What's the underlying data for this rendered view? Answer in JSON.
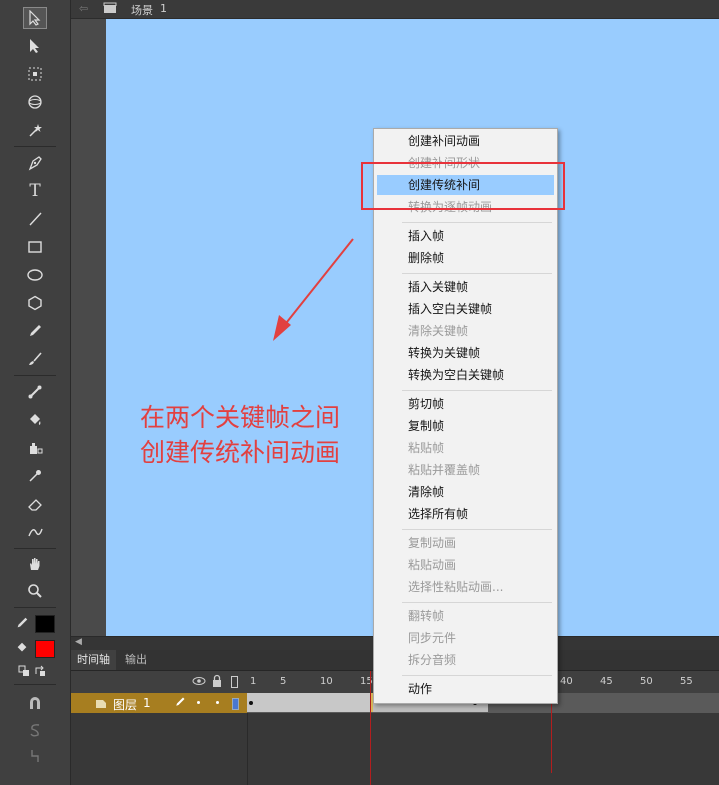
{
  "titlebar": {
    "scene_label": "场景",
    "scene_number": "1"
  },
  "timeline": {
    "tabs": [
      "时间轴",
      "输出"
    ],
    "ruler_ticks": [
      "1",
      "5",
      "10",
      "15",
      "40",
      "45",
      "50",
      "55"
    ],
    "layer_name": "图层",
    "layer_number": "1"
  },
  "fill_color": "#ff0000",
  "stroke_color": "#000000",
  "stage_color": "#99ccfe",
  "annotation": {
    "line1": "在两个关键帧之间",
    "line2": "创建传统补间动画"
  },
  "context_menu": {
    "items": [
      {
        "label": "创建补间动画",
        "enabled": true
      },
      {
        "label": "创建补间形状",
        "enabled": false
      },
      {
        "label": "创建传统补间",
        "enabled": true,
        "highlighted": true
      },
      {
        "label": "转换为逐帧动画",
        "enabled": false
      },
      {
        "label": "插入帧",
        "enabled": true
      },
      {
        "label": "删除帧",
        "enabled": true
      },
      {
        "label": "插入关键帧",
        "enabled": true
      },
      {
        "label": "插入空白关键帧",
        "enabled": true
      },
      {
        "label": "清除关键帧",
        "enabled": false
      },
      {
        "label": "转换为关键帧",
        "enabled": true
      },
      {
        "label": "转换为空白关键帧",
        "enabled": true
      },
      {
        "label": "剪切帧",
        "enabled": true
      },
      {
        "label": "复制帧",
        "enabled": true
      },
      {
        "label": "粘贴帧",
        "enabled": false
      },
      {
        "label": "粘贴并覆盖帧",
        "enabled": false
      },
      {
        "label": "清除帧",
        "enabled": true
      },
      {
        "label": "选择所有帧",
        "enabled": true
      },
      {
        "label": "复制动画",
        "enabled": false
      },
      {
        "label": "粘贴动画",
        "enabled": false
      },
      {
        "label": "选择性粘贴动画...",
        "enabled": false
      },
      {
        "label": "翻转帧",
        "enabled": false
      },
      {
        "label": "同步元件",
        "enabled": false
      },
      {
        "label": "拆分音频",
        "enabled": false
      },
      {
        "label": "动作",
        "enabled": true
      }
    ]
  }
}
